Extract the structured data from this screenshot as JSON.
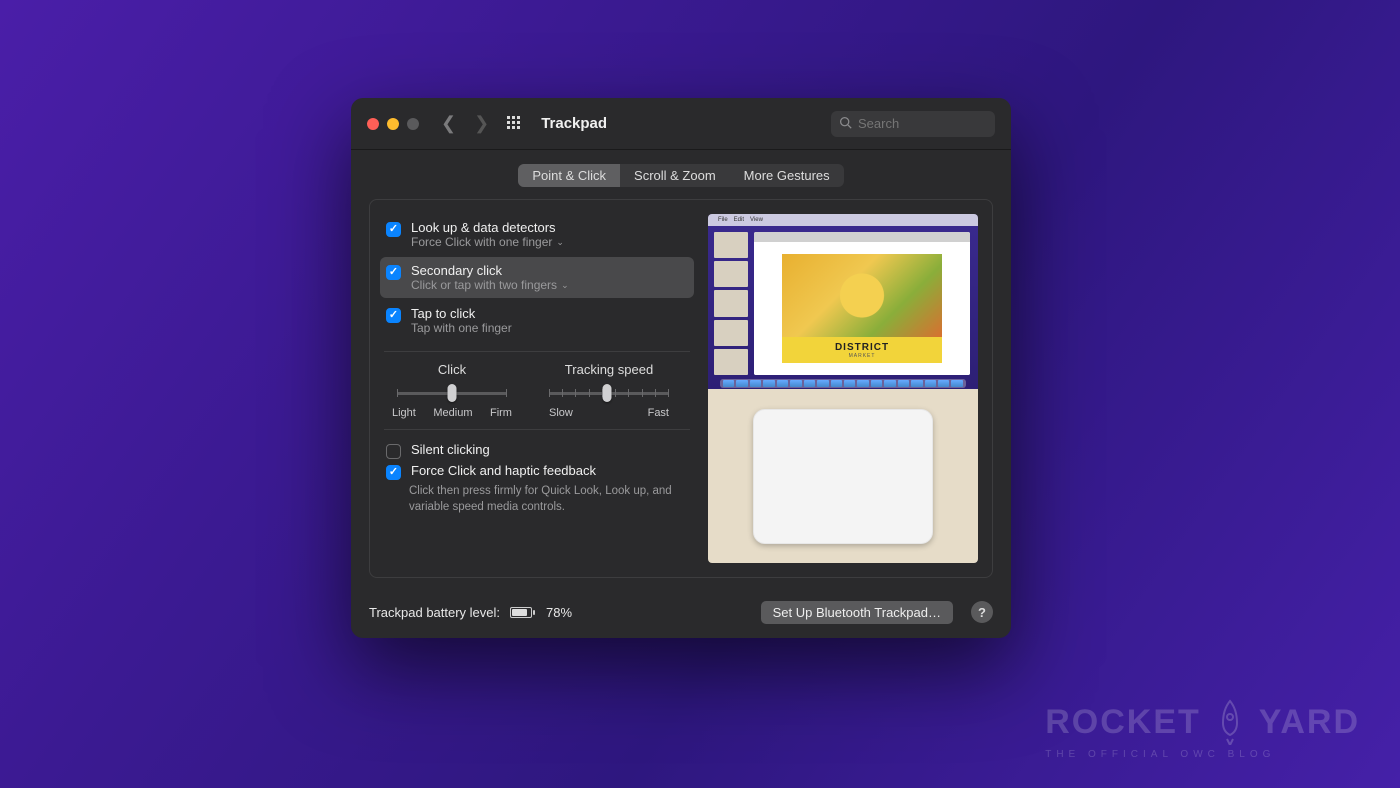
{
  "window": {
    "title": "Trackpad",
    "search_placeholder": "Search"
  },
  "tabs": {
    "point_click": "Point & Click",
    "scroll_zoom": "Scroll & Zoom",
    "more_gestures": "More Gestures"
  },
  "options": {
    "lookup": {
      "title": "Look up & data detectors",
      "sub": "Force Click with one finger"
    },
    "secondary": {
      "title": "Secondary click",
      "sub": "Click or tap with two fingers"
    },
    "tap": {
      "title": "Tap to click",
      "sub": "Tap with one finger"
    },
    "silent": {
      "title": "Silent clicking"
    },
    "force": {
      "title": "Force Click and haptic feedback",
      "desc": "Click then press firmly for Quick Look, Look up, and variable speed media controls."
    }
  },
  "sliders": {
    "click": {
      "label": "Click",
      "left": "Light",
      "mid": "Medium",
      "right": "Firm"
    },
    "tracking": {
      "label": "Tracking speed",
      "left": "Slow",
      "right": "Fast"
    }
  },
  "preview": {
    "poster_title": "DISTRICT",
    "poster_sub": "MARKET"
  },
  "footer": {
    "battery_label": "Trackpad battery level:",
    "battery_pct": "78%",
    "setup_btn": "Set Up Bluetooth Trackpad…",
    "help": "?"
  },
  "watermark": {
    "brand_l": "ROCKET",
    "brand_r": "YARD",
    "tag": "THE OFFICIAL OWC BLOG"
  }
}
